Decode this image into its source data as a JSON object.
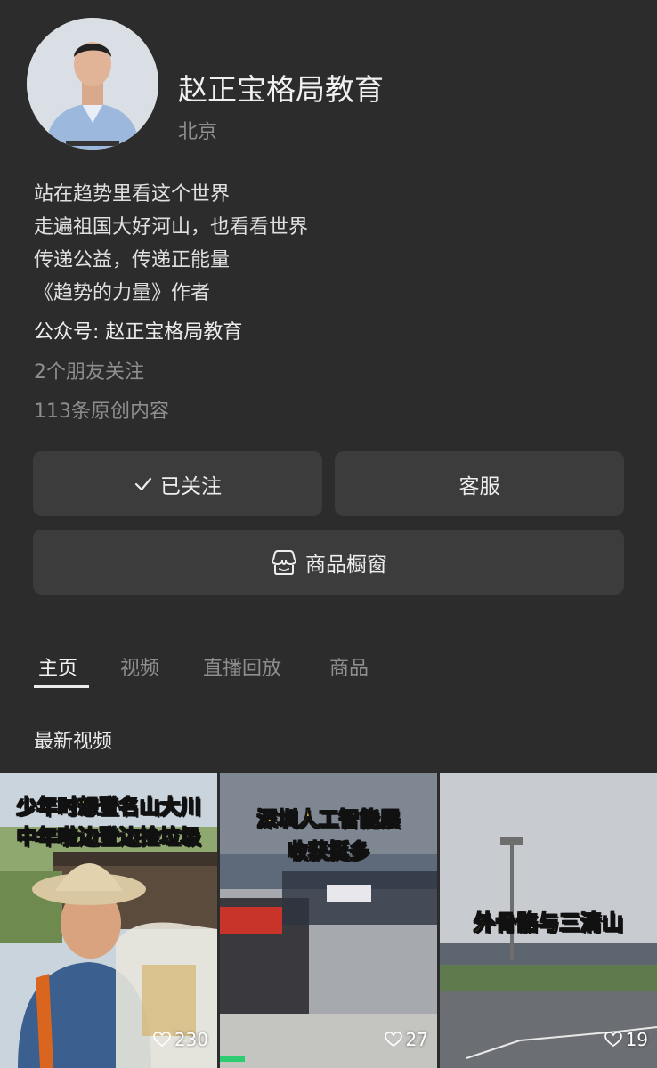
{
  "profile": {
    "name": "赵正宝格局教育",
    "location": "北京",
    "bio": [
      "站在趋势里看这个世界",
      "走遍祖国大好河山，也看看世界",
      "传递公益，传递正能量",
      "《趋势的力量》作者"
    ],
    "official_account": "公众号: 赵正宝格局教育",
    "friends_follow": "2个朋友关注",
    "original_count": "113条原创内容"
  },
  "buttons": {
    "follow_label": "已关注",
    "service_label": "客服",
    "shop_label": "商品橱窗"
  },
  "tabs": [
    "主页",
    "视频",
    "直播回放",
    "商品"
  ],
  "section_title": "最新视频",
  "videos": [
    {
      "caption_lines": [
        "少年时想登名山大川",
        "中年啦边登边捡垃圾"
      ],
      "likes": "230"
    },
    {
      "caption_lines": [
        "深圳人工智能展",
        "收获挺多"
      ],
      "likes": "27"
    },
    {
      "caption_lines": [
        "外骨骼与三清山"
      ],
      "likes": "19"
    }
  ],
  "icons": {
    "check": "check-icon",
    "shop": "shop-window-icon",
    "heart": "heart-icon"
  },
  "colors": {
    "background": "#2c2c2c",
    "button": "#3c3c3c",
    "caption": "#ffd52a"
  }
}
